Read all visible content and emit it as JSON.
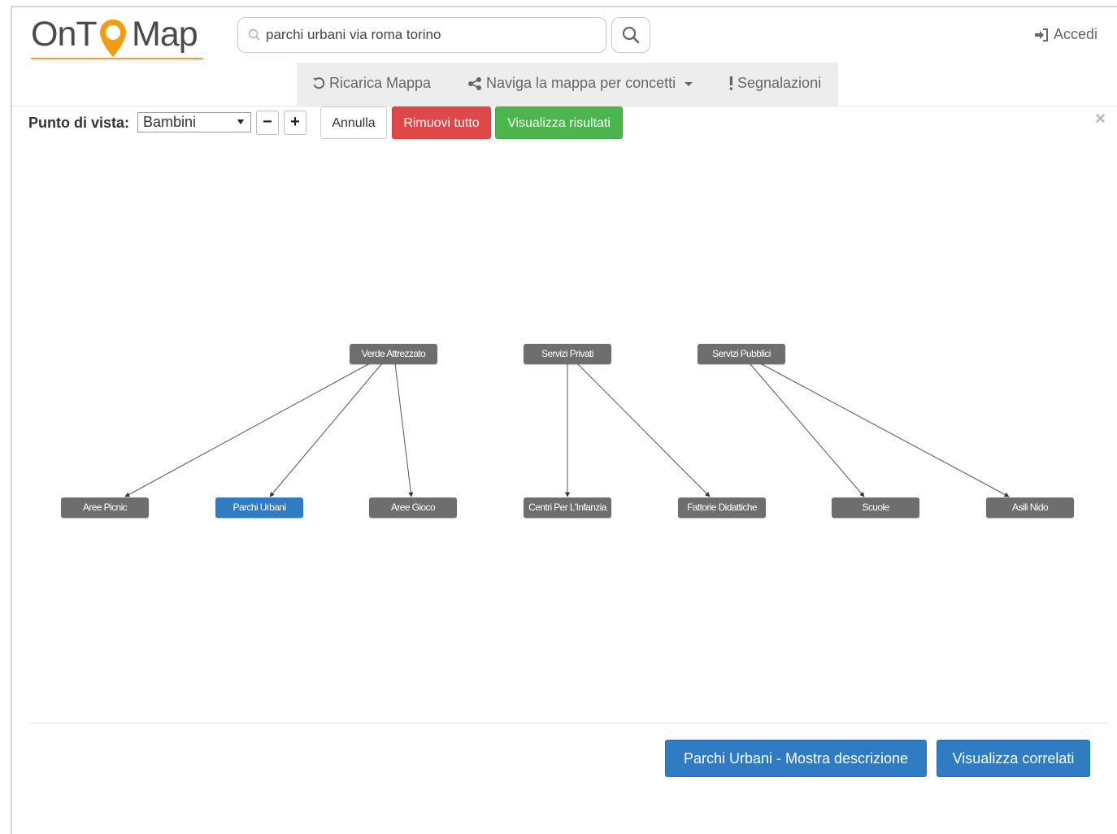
{
  "app": {
    "logo_parts": [
      "OnT",
      "Map"
    ],
    "login_label": "Accedi"
  },
  "search": {
    "value": "parchi urbani via roma torino"
  },
  "nav": {
    "items": [
      {
        "label": "Ricarica Mappa",
        "icon": "refresh-icon"
      },
      {
        "label": "Naviga la mappa per concetti",
        "icon": "share-icon"
      },
      {
        "label": "Segnalazioni",
        "icon": "exclamation-icon"
      }
    ]
  },
  "toolbar": {
    "viewpoint_label": "Punto di vista:",
    "viewpoint_value": "Bambini",
    "minus": "−",
    "plus": "+",
    "cancel_label": "Annulla",
    "remove_all_label": "Rimuovi tutto",
    "show_results_label": "Visualizza risultati",
    "close_label": "×"
  },
  "graph": {
    "parents": [
      {
        "label": "Verde Attrezzato",
        "children": [
          "Aree Picnic",
          "Parchi Urbani",
          "Aree Gioco"
        ]
      },
      {
        "label": "Servizi Privati",
        "children": [
          "Centri Per L'Infanzia",
          "Fattorie Didattiche"
        ]
      },
      {
        "label": "Servizi Pubblici",
        "children": [
          "Scuole",
          "Asili Nido"
        ]
      }
    ],
    "children": [
      "Aree Picnic",
      "Parchi Urbani",
      "Aree Gioco",
      "Centri Per L'Infanzia",
      "Fattorie Didattiche",
      "Scuole",
      "Asili Nido"
    ],
    "selected": "Parchi Urbani"
  },
  "footer": {
    "describe_label": "Parchi Urbani - Mostra descrizione",
    "related_label": "Visualizza correlati"
  },
  "colors": {
    "node": "#6e6e6e",
    "node_selected": "#2f7cc3",
    "danger": "#df4848",
    "success": "#4cb54c",
    "primary": "#2f7cc3",
    "logo_accent": "#f39c12"
  }
}
